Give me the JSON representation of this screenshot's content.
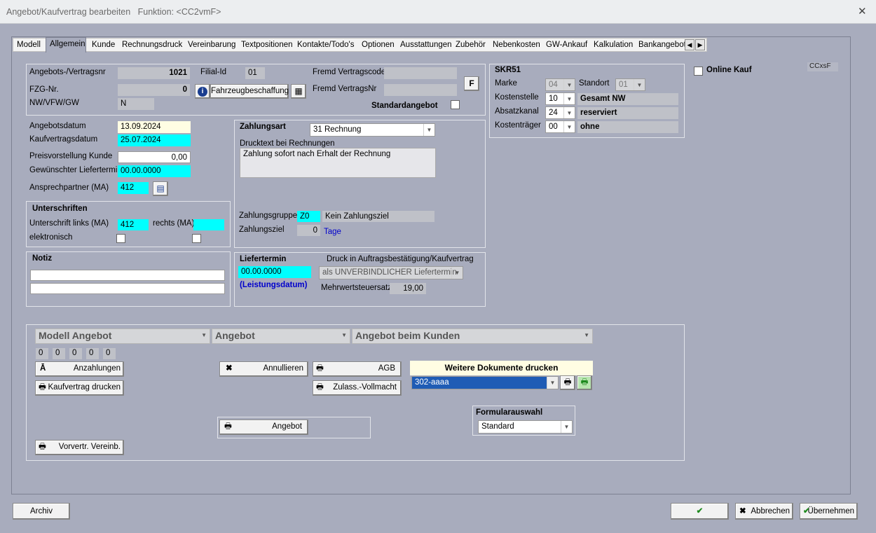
{
  "window": {
    "title": "Angebot/Kaufvertrag bearbeiten",
    "function_label": "Funktion: <CC2vmF>"
  },
  "tabs": [
    "Modell",
    "Allgemein",
    "Kunde",
    "Rechnungsdruck",
    "Vereinbarung",
    "Textpositionen",
    "Kontakte/Todo's",
    "Optionen",
    "Ausstattungen",
    "Zubehör",
    "Nebenkosten",
    "GW-Ankauf",
    "Kalkulation",
    "Bankangebot"
  ],
  "header": {
    "angebots_nr_label": "Angebots-/Vertragsnr",
    "angebots_nr": "1021",
    "filial_label": "Filial-Id",
    "filial": "01",
    "fremd_code_label": "Fremd Vertragscode",
    "fremd_code": "",
    "fzg_label": "FZG-Nr.",
    "fzg": "0",
    "fahrzeug_button": "Fahrzeugbeschaffung",
    "fremd_nr_label": "Fremd VertragsNr",
    "fremd_nr": "",
    "f_button": "F",
    "nw_label": "NW/VFW/GW",
    "nw": "N",
    "standard_label": "Standardangebot"
  },
  "dates": {
    "angebotsdatum_label": "Angebotsdatum",
    "angebotsdatum": "13.09.2024",
    "kaufvertragsdatum_label": "Kaufvertragsdatum",
    "kaufvertragsdatum": "25.07.2024",
    "preis_label": "Preisvorstellung Kunde",
    "preis": "0,00",
    "liefertermin_label": "Gewünschter Liefertermin",
    "liefertermin": "00.00.0000",
    "ansprech_label": "Ansprechpartner (MA)",
    "ansprech": "412"
  },
  "unterschriften": {
    "title": "Unterschriften",
    "links_label": "Unterschrift links (MA)",
    "links": "412",
    "rechts_label": "rechts (MA)",
    "rechts": "",
    "elektronisch_label": "elektronisch"
  },
  "notiz": {
    "title": "Notiz",
    "line1": "",
    "line2": ""
  },
  "zahlung": {
    "title": "Zahlungsart",
    "art": "31  Rechnung",
    "drucktext_label": "Drucktext bei Rechnungen",
    "drucktext": "Zahlung sofort nach Erhalt der Rechnung",
    "gruppe_label": "Zahlungsgruppe",
    "gruppe": "Z0",
    "gruppe_text": "Kein Zahlungsziel",
    "ziel_label": "Zahlungsziel",
    "ziel": "0",
    "ziel_unit": "Tage"
  },
  "lieferung": {
    "title": "Liefertermin",
    "druck_label": "Druck in Auftragsbestätigung/Kaufvertrag",
    "termin": "00.00.0000",
    "druck_option": "als UNVERBINDLICHER Liefertermin",
    "leistung": "(Leistungsdatum)",
    "mwst_label": "Mehrwertsteuersatz",
    "mwst": "19,00"
  },
  "skr": {
    "title": "SKR51",
    "marke_label": "Marke",
    "marke": "04",
    "standort_label": "Standort",
    "standort": "01",
    "kst_label": "Kostenstelle",
    "kst": "10",
    "kst_text": "Gesamt NW",
    "absatz_label": "Absatzkanal",
    "absatz": "24",
    "absatz_text": "reserviert",
    "ktr_label": "Kostenträger",
    "ktr": "00",
    "ktr_text": "ohne"
  },
  "online_kauf_label": "Online Kauf",
  "ccxsf": "CCxsF",
  "druck": {
    "combo1": "Modell Angebot",
    "combo2": "Angebot",
    "combo3": "Angebot beim Kunden",
    "counters": [
      "0",
      "0",
      "0",
      "0",
      "0"
    ],
    "anzahlungen": "Anzahlungen",
    "kaufvertrag": "Kaufvertrag drucken",
    "annullieren": "Annullieren",
    "agb": "AGB",
    "zulass": "Zulass.-Vollmacht",
    "angebot": "Angebot",
    "vorvertr": "Vorvertr. Vereinb.",
    "weitere_title": "Weitere Dokumente drucken",
    "weitere_value": "302-aaaa",
    "formular_title": "Formularauswahl",
    "formular_value": "Standard"
  },
  "footer": {
    "archiv": "Archiv",
    "ok": "",
    "abbrechen": "Abbrechen",
    "uebernehmen": "Übernehmen"
  },
  "colors": {
    "bg": "#a8acbd",
    "cyan": "#00ffff",
    "gray_field": "#bfc1c8",
    "link_blue": "#0000cc"
  }
}
